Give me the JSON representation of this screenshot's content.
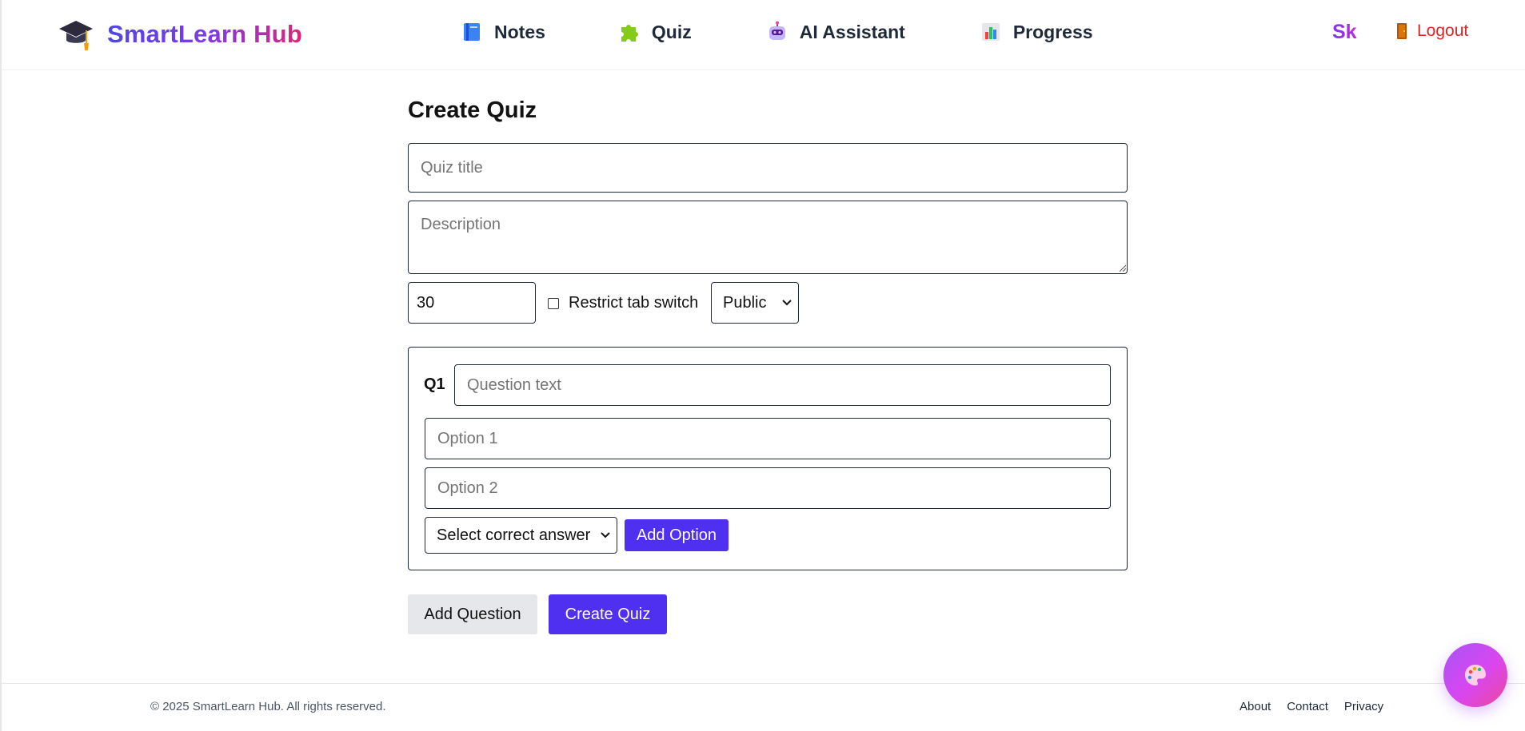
{
  "header": {
    "brand_name": "SmartLearn Hub",
    "brand_icon": "graduation-cap-icon",
    "nav": [
      {
        "label": "Notes",
        "icon": "book-icon"
      },
      {
        "label": "Quiz",
        "icon": "puzzle-icon"
      },
      {
        "label": "AI Assistant",
        "icon": "robot-icon"
      },
      {
        "label": "Progress",
        "icon": "bar-chart-icon"
      }
    ],
    "user_initials": "Sk",
    "logout_label": "Logout",
    "logout_icon": "door-icon"
  },
  "main": {
    "title": "Create Quiz",
    "quiz_title_placeholder": "Quiz title",
    "description_placeholder": "Description",
    "time_limit_value": "30",
    "restrict_tab_switch_label": "Restrict tab switch",
    "restrict_tab_switch_checked": false,
    "visibility_value": "Public",
    "questions": [
      {
        "label": "Q1",
        "text_placeholder": "Question text",
        "options": [
          {
            "placeholder": "Option 1"
          },
          {
            "placeholder": "Option 2"
          }
        ],
        "correct_answer_value": "Select correct answer",
        "add_option_label": "Add Option"
      }
    ],
    "add_question_label": "Add Question",
    "create_quiz_label": "Create Quiz"
  },
  "footer": {
    "copyright": "© 2025 SmartLearn Hub. All rights reserved.",
    "links": [
      "About",
      "Contact",
      "Privacy"
    ]
  },
  "fab": {
    "icon": "palette-icon"
  },
  "colors": {
    "primary": "#4f2ff0",
    "logout": "#dc2626",
    "brand_gradient_start": "#4f46e5",
    "brand_gradient_end": "#db2777"
  }
}
